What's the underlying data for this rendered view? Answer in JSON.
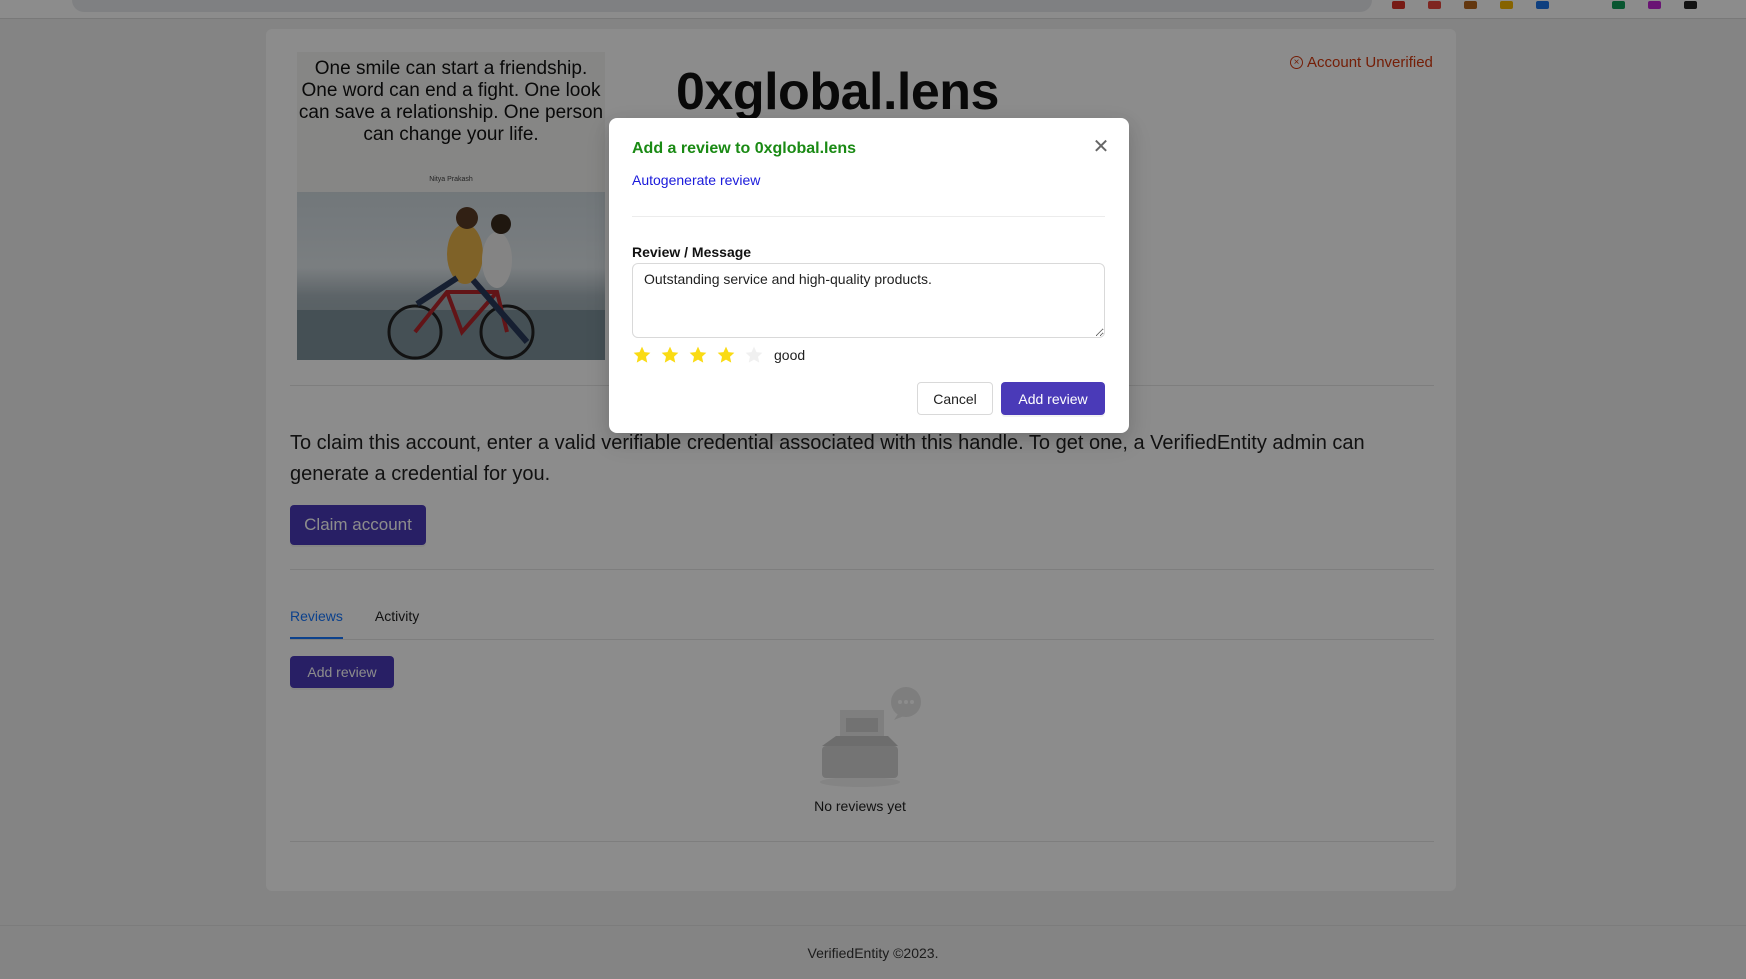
{
  "profile": {
    "title": "0xglobal.lens",
    "status": "Account Unverified",
    "image": {
      "quote": "One smile can start a friendship. One word can end a fight. One look can save a relationship. One person can change your life.",
      "author": "Nitya Prakash"
    }
  },
  "claim": {
    "text": "To claim this account, enter a valid verifiable credential associated with this handle. To get one, a VerifiedEntity admin can generate a credential for you.",
    "button_label": "Claim account"
  },
  "tabs": [
    {
      "label": "Reviews",
      "active": true
    },
    {
      "label": "Activity",
      "active": false
    }
  ],
  "reviews": {
    "add_button_label": "Add review",
    "empty_text": "No reviews yet"
  },
  "footer": {
    "text": "VerifiedEntity ©2023."
  },
  "modal": {
    "title": "Add a review to 0xglobal.lens",
    "autogenerate_label": "Autogenerate review",
    "field_label": "Review / Message",
    "message_value": "Outstanding service and high-quality products.",
    "rating": {
      "value": 4,
      "max": 5,
      "text": "good"
    },
    "cancel_label": "Cancel",
    "submit_label": "Add review"
  },
  "colors": {
    "primary": "#4a3ab8",
    "title_green": "#1a8a14",
    "link_blue": "#1a1adb",
    "tab_active": "#1677ff",
    "unverified_red": "#d4380d",
    "star_filled": "#fadb14",
    "star_empty": "#f0f0f0"
  }
}
